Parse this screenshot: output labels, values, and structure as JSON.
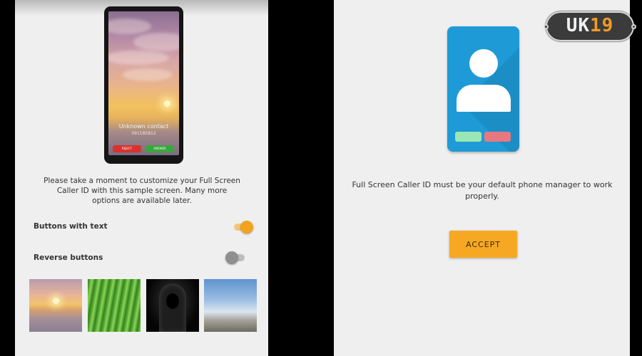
{
  "left_screen": {
    "preview": {
      "contact_name": "Unknown contact",
      "contact_number": "091185812",
      "decline_label": "REJECT",
      "answer_label": "ANSWER"
    },
    "intro_text": "Please take a moment to customize your Full Screen Caller ID with this sample screen. Many more options are available later.",
    "settings": [
      {
        "label": "Buttons with text",
        "enabled": true
      },
      {
        "label": "Reverse buttons",
        "enabled": false
      }
    ],
    "backgrounds": [
      "sunset-clouds",
      "green-grass",
      "hooded-figure",
      "blue-sky-hills"
    ]
  },
  "right_screen": {
    "notice_text": "Full Screen Caller ID must be your default phone manager to work properly.",
    "accept_label": "ACCEPT",
    "colors": {
      "phone": "#1e9bd7",
      "accept": "#f7a823",
      "answer": "#9ae6b4",
      "decline": "#e8777e"
    }
  },
  "watermark": {
    "text_main": "UK",
    "text_accent": "19"
  },
  "colors": {
    "toggle_on": "#f4a21e",
    "toggle_off": "#8f8f8f"
  }
}
